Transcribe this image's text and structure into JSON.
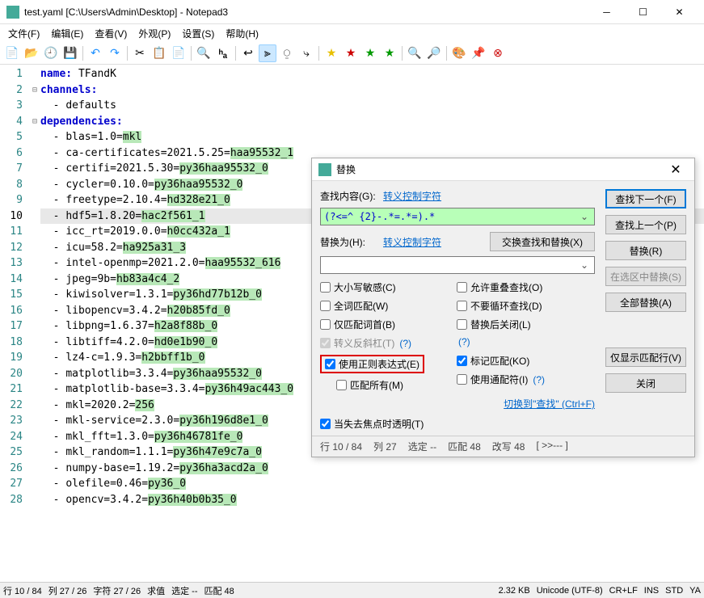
{
  "window": {
    "title": "test.yaml [C:\\Users\\Admin\\Desktop] - Notepad3"
  },
  "menu": {
    "file": "文件(F)",
    "edit": "编辑(E)",
    "view": "查看(V)",
    "appearance": "外观(P)",
    "settings": "设置(S)",
    "help": "帮助(H)"
  },
  "lines": [
    {
      "n": 1,
      "fold": "",
      "pre": "",
      "kw": "name:",
      "rest": " TFandK"
    },
    {
      "n": 2,
      "fold": "⊟",
      "pre": "",
      "kw": "channels:",
      "rest": ""
    },
    {
      "n": 3,
      "fold": "",
      "pre": "  ",
      "dash": "- ",
      "rest": "defaults"
    },
    {
      "n": 4,
      "fold": "⊟",
      "pre": "",
      "kw": "dependencies:",
      "rest": ""
    },
    {
      "n": 5,
      "fold": "",
      "pre": "  ",
      "dash": "- ",
      "rest": "blas=1.0=",
      "hl": "mkl"
    },
    {
      "n": 6,
      "fold": "",
      "pre": "  ",
      "dash": "- ",
      "rest": "ca-certificates=2021.5.25=",
      "hl": "haa95532_1"
    },
    {
      "n": 7,
      "fold": "",
      "pre": "  ",
      "dash": "- ",
      "rest": "certifi=2021.5.30=",
      "hl": "py36haa95532_0"
    },
    {
      "n": 8,
      "fold": "",
      "pre": "  ",
      "dash": "- ",
      "rest": "cycler=0.10.0=",
      "hl": "py36haa95532_0"
    },
    {
      "n": 9,
      "fold": "",
      "pre": "  ",
      "dash": "- ",
      "rest": "freetype=2.10.4=",
      "hl": "hd328e21_0"
    },
    {
      "n": 10,
      "fold": "",
      "pre": "  ",
      "dash": "- ",
      "rest": "hdf5=1.8.20=",
      "hl": "hac2f561_1",
      "curr": true
    },
    {
      "n": 11,
      "fold": "",
      "pre": "  ",
      "dash": "- ",
      "rest": "icc_rt=2019.0.0=",
      "hl": "h0cc432a_1"
    },
    {
      "n": 12,
      "fold": "",
      "pre": "  ",
      "dash": "- ",
      "rest": "icu=58.2=",
      "hl": "ha925a31_3"
    },
    {
      "n": 13,
      "fold": "",
      "pre": "  ",
      "dash": "- ",
      "rest": "intel-openmp=2021.2.0=",
      "hl": "haa95532_616"
    },
    {
      "n": 14,
      "fold": "",
      "pre": "  ",
      "dash": "- ",
      "rest": "jpeg=9b=",
      "hl": "hb83a4c4_2"
    },
    {
      "n": 15,
      "fold": "",
      "pre": "  ",
      "dash": "- ",
      "rest": "kiwisolver=1.3.1=",
      "hl": "py36hd77b12b_0"
    },
    {
      "n": 16,
      "fold": "",
      "pre": "  ",
      "dash": "- ",
      "rest": "libopencv=3.4.2=",
      "hl": "h20b85fd_0"
    },
    {
      "n": 17,
      "fold": "",
      "pre": "  ",
      "dash": "- ",
      "rest": "libpng=1.6.37=",
      "hl": "h2a8f88b_0"
    },
    {
      "n": 18,
      "fold": "",
      "pre": "  ",
      "dash": "- ",
      "rest": "libtiff=4.2.0=",
      "hl": "hd0e1b90_0"
    },
    {
      "n": 19,
      "fold": "",
      "pre": "  ",
      "dash": "- ",
      "rest": "lz4-c=1.9.3=",
      "hl": "h2bbff1b_0"
    },
    {
      "n": 20,
      "fold": "",
      "pre": "  ",
      "dash": "- ",
      "rest": "matplotlib=3.3.4=",
      "hl": "py36haa95532_0"
    },
    {
      "n": 21,
      "fold": "",
      "pre": "  ",
      "dash": "- ",
      "rest": "matplotlib-base=3.3.4=",
      "hl": "py36h49ac443_0"
    },
    {
      "n": 22,
      "fold": "",
      "pre": "  ",
      "dash": "- ",
      "rest": "mkl=2020.2=",
      "hl": "256"
    },
    {
      "n": 23,
      "fold": "",
      "pre": "  ",
      "dash": "- ",
      "rest": "mkl-service=2.3.0=",
      "hl": "py36h196d8e1_0"
    },
    {
      "n": 24,
      "fold": "",
      "pre": "  ",
      "dash": "- ",
      "rest": "mkl_fft=1.3.0=",
      "hl": "py36h46781fe_0"
    },
    {
      "n": 25,
      "fold": "",
      "pre": "  ",
      "dash": "- ",
      "rest": "mkl_random=1.1.1=",
      "hl": "py36h47e9c7a_0"
    },
    {
      "n": 26,
      "fold": "",
      "pre": "  ",
      "dash": "- ",
      "rest": "numpy-base=1.19.2=",
      "hl": "py36ha3acd2a_0"
    },
    {
      "n": 27,
      "fold": "",
      "pre": "  ",
      "dash": "- ",
      "rest": "olefile=0.46=",
      "hl": "py36_0"
    },
    {
      "n": 28,
      "fold": "",
      "pre": "  ",
      "dash": "- ",
      "rest": "opencv=3.4.2=",
      "hl": "py36h40b0b35_0"
    }
  ],
  "dialog": {
    "title": "替换",
    "findLabel": "查找内容(G):",
    "escLink": "转义控制字符",
    "findText": "(?<=^ {2}-.*=.*=).*",
    "replaceLabel": "替换为(H):",
    "replaceText": "",
    "swapBtn": "交换查找和替换(X)",
    "findNext": "查找下一个(F)",
    "findPrev": "查找上一个(P)",
    "replace": "替换(R)",
    "replaceSel": "在选区中替换(S)",
    "replaceAll": "全部替换(A)",
    "showMatch": "仅显示匹配行(V)",
    "close": "关闭",
    "chk": {
      "case": "大小写敏感(C)",
      "overlap": "允许重叠查找(O)",
      "word": "全词匹配(W)",
      "wrap": "不要循环查找(D)",
      "start": "仅匹配词首(B)",
      "closeAfter": "替换后关闭(L)",
      "escape": "转义反斜杠(T)",
      "regex": "使用正则表达式(E)",
      "mark": "标记匹配(KO)",
      "dotall": "匹配所有(M)",
      "wildcard": "使用通配符(I)",
      "transparent": "当失去焦点时透明(T)"
    },
    "switchFind": "切换到\"查找\" (Ctrl+F)",
    "status": {
      "line": "行  10 / 84",
      "col": "列  27",
      "sel": "选定  --",
      "match": "匹配  48",
      "repl": "改写  48",
      "wrap": "[ >>--- ]"
    }
  },
  "status": {
    "line": "行  10 / 84",
    "col": "列  27 / 26",
    "char": "字符  27 / 26",
    "val": "求值",
    "sel": "选定  --",
    "match": "匹配  48",
    "size": "2.32 KB",
    "enc": "Unicode (UTF-8)",
    "eol": "CR+LF",
    "ins": "INS",
    "std": "STD",
    "lang": "YA"
  }
}
